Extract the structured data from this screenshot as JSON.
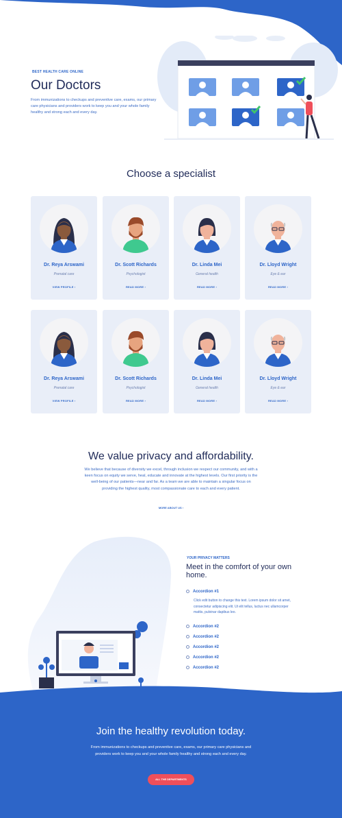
{
  "colors": {
    "brand_blue": "#2d65c8",
    "dark_navy": "#1f2a58",
    "card_bg": "#e9eef8",
    "cta_red": "#ef4f5a",
    "band_blue": "#2d65c8"
  },
  "hero": {
    "eyebrow": "BEST HEALTH CARE ONLINE",
    "title": "Our Doctors",
    "text": "From immunizations to checkups and  preventive care,  exams, our primary care physicians and providers work to keep you and your whole family healthy and strong each and every day."
  },
  "specialists": {
    "title": "Choose a specialist",
    "cards": [
      {
        "name": "Dr. Reya Arswami",
        "specialty": "Prenatal care",
        "link": "VIEW PROFILE  ›",
        "avatar": "woman-dark-skin-avatar"
      },
      {
        "name": "Dr. Scott Richards",
        "specialty": "Psychologist",
        "link": "READ MORE  ›",
        "avatar": "bearded-man-avatar"
      },
      {
        "name": "Dr. Linda Mei",
        "specialty": "General health",
        "link": "READ MORE  ›",
        "avatar": "woman-black-hair-avatar"
      },
      {
        "name": "Dr. Lloyd Wright",
        "specialty": "Eye & ear",
        "link": "READ MORE  ›",
        "avatar": "older-man-glasses-avatar"
      },
      {
        "name": "Dr. Reya Arswami",
        "specialty": "Prenatal care",
        "link": "VIEW PROFILE  ›",
        "avatar": "woman-dark-skin-avatar"
      },
      {
        "name": "Dr. Scott Richards",
        "specialty": "Psychologist",
        "link": "READ MORE  ›",
        "avatar": "bearded-man-avatar"
      },
      {
        "name": "Dr. Linda Mei",
        "specialty": "General health",
        "link": "READ MORE  ›",
        "avatar": "woman-black-hair-avatar"
      },
      {
        "name": "Dr. Lloyd Wright",
        "specialty": "Eye & ear",
        "link": "READ MORE  ›",
        "avatar": "older-man-glasses-avatar"
      }
    ]
  },
  "privacy": {
    "title": "We value privacy and affordability.",
    "text": "We believe that because of diversity we excel, through inclusion we respect our community, and with a keen focus on equity we serve, heal, educate and innovate at the highest levels. Our first priority is the well-being of our patients—near and far. As a team we are able to maintain a singular focus on providing the highest quality, most compassionate care to each and every patient.",
    "link": "MORE ABOUT US  ›"
  },
  "comfort": {
    "eyebrow": "YOUR PRIVACY MATTERS",
    "title": "Meet in the comfort of your own home.",
    "accordion": [
      {
        "label": "Accordion #1",
        "body": "Click edit button to change this text. Lorem ipsum dolor sit amet, consectetur adipiscing elit. Ut elit tellus, luctus nec ullamcorper mattis, pulvinar dapibus leo."
      },
      {
        "label": "Accordion #2"
      },
      {
        "label": "Accordion #2"
      },
      {
        "label": "Accordion #2"
      },
      {
        "label": "Accordion #2"
      },
      {
        "label": "Accordion #2"
      }
    ]
  },
  "join": {
    "title": "Join the healthy revolution today.",
    "text": "From immunizations to checkups and  preventive care,  exams, our primary care physicians and providers work to keep you and your whole family healthy and strong each and every day.",
    "button": "ALL THE DEPARTMENTS"
  }
}
